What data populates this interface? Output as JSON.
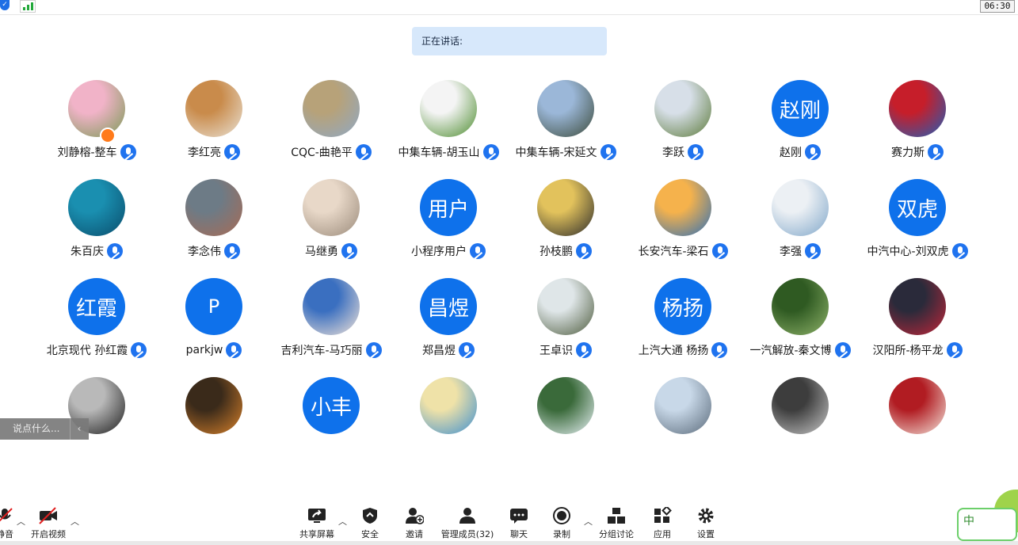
{
  "top": {
    "clock": "06:30"
  },
  "speaking_label": "正在讲话:",
  "participants": [
    {
      "name": "刘静榕-整车",
      "photo": [
        "#f1b3c8",
        "#7a9a55"
      ],
      "host": true
    },
    {
      "name": "李红亮",
      "photo": [
        "#c98b4b",
        "#e9e2d6"
      ]
    },
    {
      "name": "CQC-曲艳平",
      "photo": [
        "#b7a279",
        "#8fa8c5"
      ]
    },
    {
      "name": "中集车辆-胡玉山",
      "photo": [
        "#f4f4f4",
        "#4c8c2e"
      ]
    },
    {
      "name": "中集车辆-宋延文",
      "photo": [
        "#9bb7d8",
        "#3b4a3a"
      ]
    },
    {
      "name": "李跃",
      "photo": [
        "#d7dfe8",
        "#5c7a3a"
      ]
    },
    {
      "name": "赵刚",
      "initials": "赵刚"
    },
    {
      "name": "赛力斯",
      "photo": [
        "#c61e2a",
        "#1f5fb8"
      ]
    },
    {
      "name": "朱百庆",
      "photo": [
        "#1a8fb0",
        "#0a4c6b"
      ]
    },
    {
      "name": "李念伟",
      "photo": [
        "#6d7b86",
        "#a86b55"
      ]
    },
    {
      "name": "马继勇",
      "photo": [
        "#e8d8c8",
        "#9a8a7a"
      ]
    },
    {
      "name": "小程序用户",
      "initials": "用户"
    },
    {
      "name": "孙枝鹏",
      "photo": [
        "#e2c25c",
        "#2b2b2b"
      ]
    },
    {
      "name": "长安汽车-梁石",
      "photo": [
        "#f5b24c",
        "#2d6fb8"
      ]
    },
    {
      "name": "李强",
      "photo": [
        "#ecf0f4",
        "#7fa6c9"
      ]
    },
    {
      "name": "中汽中心-刘双虎",
      "initials": "双虎"
    },
    {
      "name": "北京现代 孙红霞",
      "initials": "红霞"
    },
    {
      "name": "parkjw",
      "initials": "P"
    },
    {
      "name": "吉利汽车-马巧丽",
      "photo": [
        "#3a6fc0",
        "#f2e4d8"
      ]
    },
    {
      "name": "郑昌煜",
      "initials": "昌煜"
    },
    {
      "name": "王卓识",
      "photo": [
        "#dfe6e8",
        "#4d5b3d"
      ]
    },
    {
      "name": "上汽大通 杨扬",
      "initials": "杨扬"
    },
    {
      "name": "一汽解放-秦文博",
      "photo": [
        "#2f5a22",
        "#8fb36a"
      ]
    },
    {
      "name": "汉阳所-杨平龙",
      "photo": [
        "#2a2a3a",
        "#c2273a"
      ]
    },
    {
      "name": "",
      "photo": [
        "#b9b9b9",
        "#1d1d1d"
      ]
    },
    {
      "name": "",
      "photo": [
        "#3a2a1a",
        "#d9822b"
      ]
    },
    {
      "name": "",
      "initials": "小丰"
    },
    {
      "name": "",
      "photo": [
        "#efe2a8",
        "#3e8fd0"
      ]
    },
    {
      "name": "",
      "photo": [
        "#3a6a3a",
        "#e8f2f6"
      ]
    },
    {
      "name": "",
      "photo": [
        "#c8d8e8",
        "#5a6a7a"
      ]
    },
    {
      "name": "",
      "photo": [
        "#3d3d3d",
        "#c9c9c9"
      ]
    },
    {
      "name": "",
      "photo": [
        "#b11c22",
        "#f4e6dc"
      ]
    }
  ],
  "chat_placeholder": "说点什么...",
  "toolbar": {
    "mute": "静音",
    "video": "开启视频",
    "share": "共享屏幕",
    "security": "安全",
    "invite": "邀请",
    "members": "管理成员(32)",
    "chat": "聊天",
    "record": "录制",
    "breakout": "分组讨论",
    "apps": "应用",
    "settings": "设置"
  },
  "ime_label": "中",
  "colors": {
    "accent": "#0e71eb",
    "banner": "#d7e8fb",
    "host_badge": "#ff7a1a"
  }
}
